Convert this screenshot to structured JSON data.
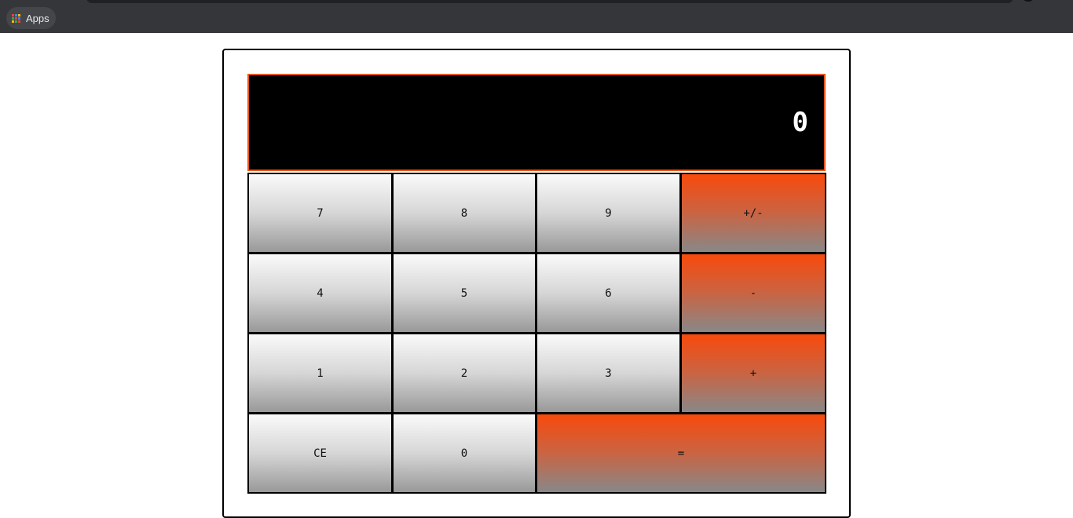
{
  "browser": {
    "apps_label": "Apps",
    "apps_icon_colors": [
      "#ea4335",
      "#4285f4",
      "#fbbc04",
      "#34a853",
      "#ea4335",
      "#4285f4",
      "#fbbc04",
      "#34a853",
      "#ea4335"
    ]
  },
  "calculator": {
    "display_value": "0",
    "keys": [
      {
        "label": "7",
        "type": "digit"
      },
      {
        "label": "8",
        "type": "digit"
      },
      {
        "label": "9",
        "type": "digit"
      },
      {
        "label": "+/-",
        "type": "operator"
      },
      {
        "label": "4",
        "type": "digit"
      },
      {
        "label": "5",
        "type": "digit"
      },
      {
        "label": "6",
        "type": "digit"
      },
      {
        "label": "-",
        "type": "operator"
      },
      {
        "label": "1",
        "type": "digit"
      },
      {
        "label": "2",
        "type": "digit"
      },
      {
        "label": "3",
        "type": "digit"
      },
      {
        "label": "+",
        "type": "operator"
      },
      {
        "label": "CE",
        "type": "digit"
      },
      {
        "label": "0",
        "type": "digit"
      },
      {
        "label": "=",
        "type": "operator"
      }
    ]
  },
  "colors": {
    "browser_bar": "#35363a",
    "display_bg": "#000000",
    "display_border": "#e8561c",
    "operator_accent": "#f84a0c"
  }
}
